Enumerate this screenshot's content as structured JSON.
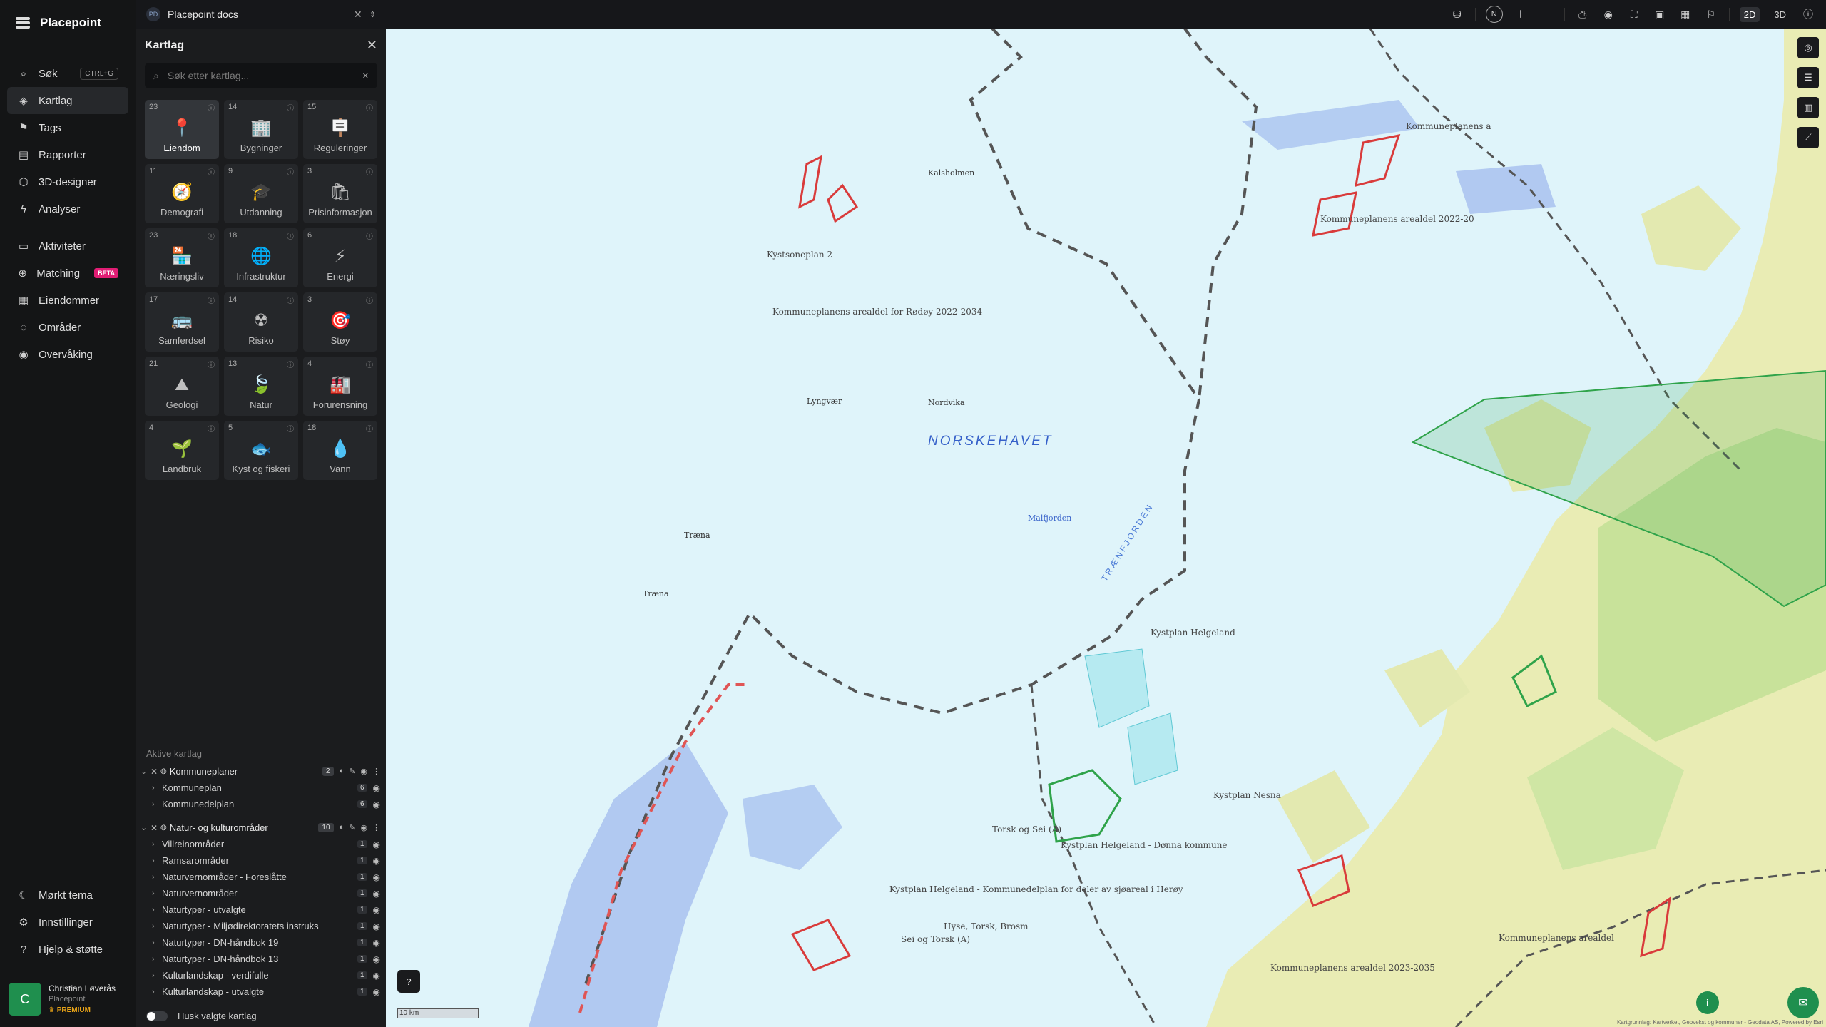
{
  "app": {
    "name": "Placepoint"
  },
  "nav": {
    "items": [
      {
        "label": "Søk",
        "shortcut": "CTRL+G",
        "icon": "search-icon"
      },
      {
        "label": "Kartlag",
        "icon": "layers-icon",
        "active": true
      },
      {
        "label": "Tags",
        "icon": "bookmark-icon"
      },
      {
        "label": "Rapporter",
        "icon": "bar-chart-icon"
      },
      {
        "label": "3D-designer",
        "icon": "cube-icon"
      },
      {
        "label": "Analyser",
        "icon": "bolt-icon"
      }
    ],
    "items2": [
      {
        "label": "Aktiviteter",
        "icon": "chat-icon"
      },
      {
        "label": "Matching",
        "badge": "BETA",
        "icon": "match-icon"
      },
      {
        "label": "Eiendommer",
        "icon": "building-icon"
      },
      {
        "label": "Områder",
        "icon": "area-icon"
      },
      {
        "label": "Overvåking",
        "icon": "watch-icon"
      }
    ],
    "bottom": [
      {
        "label": "Mørkt tema",
        "icon": "moon-icon"
      },
      {
        "label": "Innstillinger",
        "icon": "gear-icon"
      },
      {
        "label": "Hjelp & støtte",
        "icon": "help-icon"
      }
    ],
    "user": {
      "initial": "C",
      "name": "Christian Løverås",
      "org": "Placepoint",
      "plan": "PREMIUM"
    }
  },
  "doc_tab": {
    "badge": "PD",
    "title": "Placepoint docs"
  },
  "panel": {
    "title": "Kartlag",
    "search_placeholder": "Søk etter kartlag...",
    "categories": [
      {
        "label": "Eiendom",
        "count": "23",
        "icon": "📍",
        "active": true
      },
      {
        "label": "Bygninger",
        "count": "14",
        "icon": "🏢"
      },
      {
        "label": "Reguleringer",
        "count": "15",
        "icon": "🪧"
      },
      {
        "label": "Demografi",
        "count": "11",
        "icon": "🧭"
      },
      {
        "label": "Utdanning",
        "count": "9",
        "icon": "🎓"
      },
      {
        "label": "Prisinformasjon",
        "count": "3",
        "icon": "🛍"
      },
      {
        "label": "Næringsliv",
        "count": "23",
        "icon": "🏪"
      },
      {
        "label": "Infrastruktur",
        "count": "18",
        "icon": "🌐"
      },
      {
        "label": "Energi",
        "count": "6",
        "icon": "⚡"
      },
      {
        "label": "Samferdsel",
        "count": "17",
        "icon": "🚌"
      },
      {
        "label": "Risiko",
        "count": "14",
        "icon": "☢"
      },
      {
        "label": "Støy",
        "count": "3",
        "icon": "🎯"
      },
      {
        "label": "Geologi",
        "count": "21",
        "icon": "⛰"
      },
      {
        "label": "Natur",
        "count": "13",
        "icon": "🍃"
      },
      {
        "label": "Forurensning",
        "count": "4",
        "icon": "🏭"
      },
      {
        "label": "Landbruk",
        "count": "4",
        "icon": "🌱"
      },
      {
        "label": "Kyst og fiskeri",
        "count": "5",
        "icon": "🐟"
      },
      {
        "label": "Vann",
        "count": "18",
        "icon": "💧"
      }
    ],
    "active_title": "Aktive kartlag",
    "groups": [
      {
        "name": "Kommuneplaner",
        "count": "2",
        "layers": [
          {
            "name": "Kommuneplan",
            "count": "6"
          },
          {
            "name": "Kommunedelplan",
            "count": "6"
          }
        ]
      },
      {
        "name": "Natur- og kulturområder",
        "count": "10",
        "layers": [
          {
            "name": "Villreinområder",
            "count": "1"
          },
          {
            "name": "Ramsarområder",
            "count": "1"
          },
          {
            "name": "Naturvernområder - Foreslåtte",
            "count": "1"
          },
          {
            "name": "Naturvernområder",
            "count": "1"
          },
          {
            "name": "Naturtyper - utvalgte",
            "count": "1"
          },
          {
            "name": "Naturtyper - Miljødirektoratets instruks",
            "count": "1"
          },
          {
            "name": "Naturtyper - DN-håndbok 19",
            "count": "1"
          },
          {
            "name": "Naturtyper - DN-håndbok 13",
            "count": "1"
          },
          {
            "name": "Kulturlandskap - verdifulle",
            "count": "1"
          },
          {
            "name": "Kulturlandskap - utvalgte",
            "count": "1"
          }
        ]
      }
    ],
    "remember_label": "Husk valgte kartlag"
  },
  "toolbar": {
    "north": "N",
    "mode_2d": "2D",
    "mode_3d": "3D"
  },
  "map": {
    "sea_label": "NORSKEHAVET",
    "fjord_label": "TRÆNFJORDEN",
    "places": [
      "Træna",
      "Træna",
      "Lyngvær",
      "Nordvika",
      "Malfjorden",
      "Kalsholmen"
    ],
    "plan_labels": [
      "Kystsoneplan 2",
      "Kommuneplanens arealdel for Rødøy 2022-2034",
      "Kommuneplanens arealdel 2022-20",
      "Kystplan Helgeland",
      "Kystplan Helgeland - Dønna kommune",
      "Kystplan Helgeland - Kommunedelplan for deler av sjøareal i Herøy",
      "Kystplan Nesna",
      "Kommuneplanens arealdel 2023-2035",
      "Kommuneplanens arealdel",
      "Kommuneplanens a",
      "Torsk og Sei (A)",
      "Hyse, Torsk, Brosm",
      "Sei og Torsk (A)"
    ],
    "scale": "10 km",
    "attribution": "Kartgrunnlag: Kartverket, Geovekst og kommuner - Geodata AS, Powered by Esri",
    "colors": {
      "sea": "#dff4fa",
      "land": "#e9ecb4",
      "forest": "#c8e29a",
      "boundary": "#555555",
      "red_zone": "#d93b3b",
      "green_zone": "#2fa34a"
    }
  }
}
